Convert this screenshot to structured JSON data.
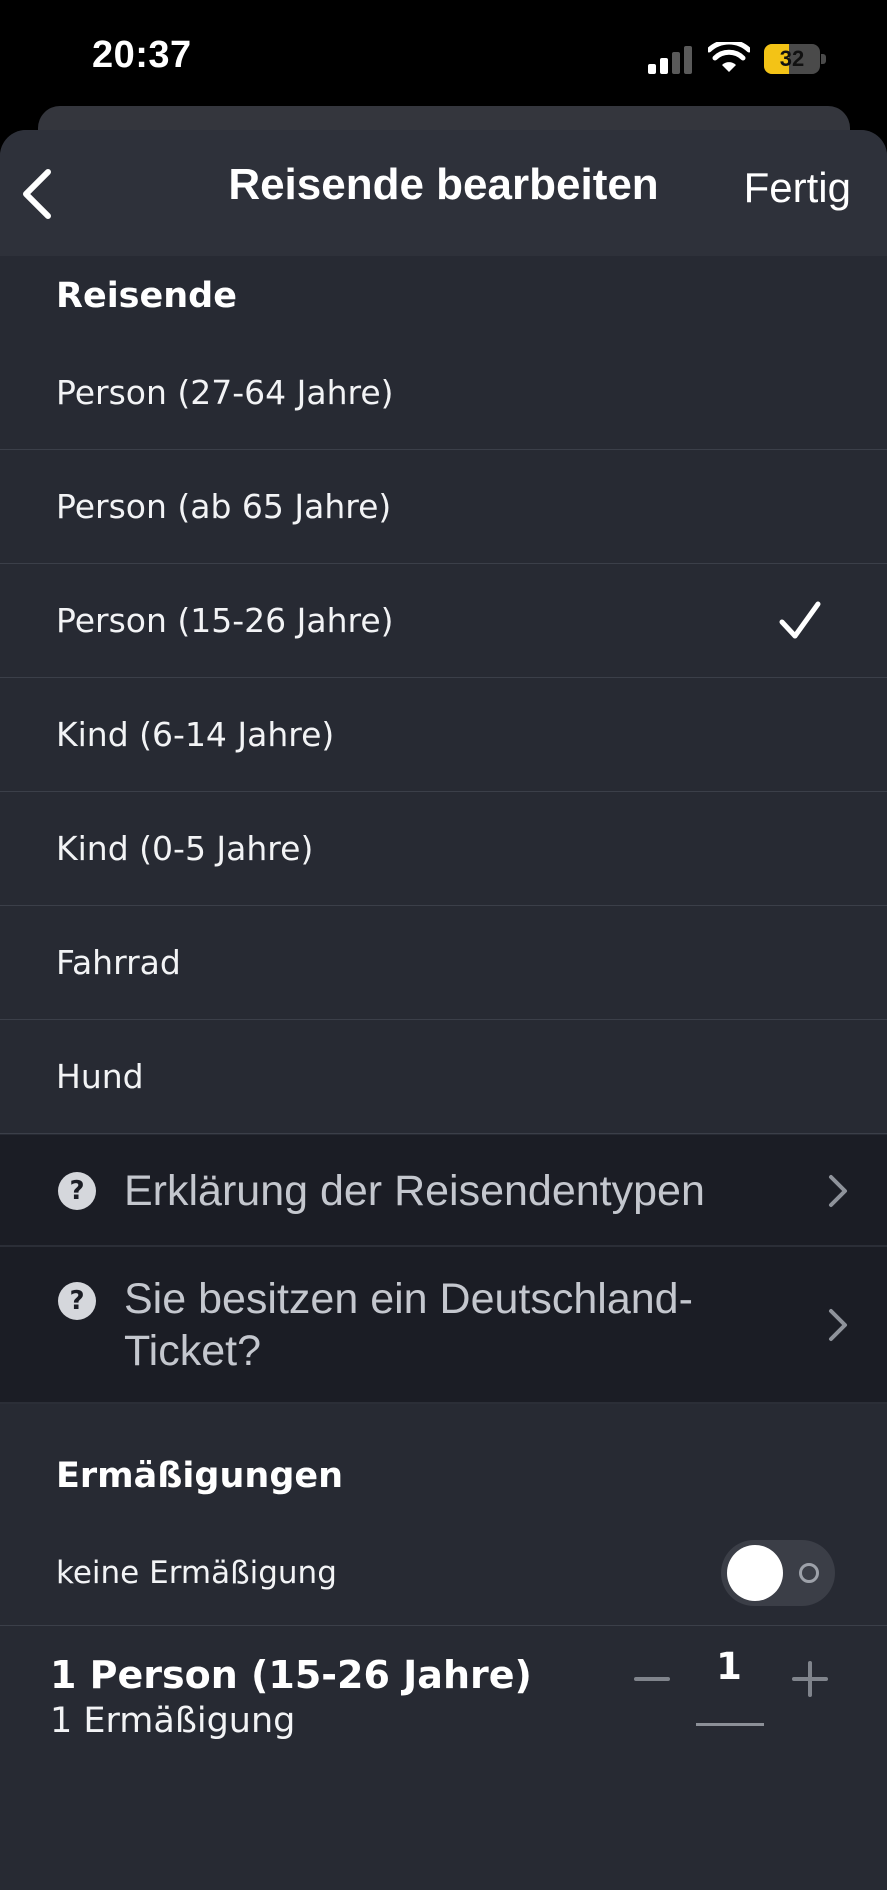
{
  "status_bar": {
    "time": "20:37",
    "battery_level": "32"
  },
  "nav": {
    "title": "Reisende bearbeiten",
    "done_label": "Fertig"
  },
  "travellers": {
    "title": "Reisende",
    "items": [
      {
        "label": "Person (27-64 Jahre)",
        "selected": false
      },
      {
        "label": "Person (ab 65 Jahre)",
        "selected": false
      },
      {
        "label": "Person (15-26 Jahre)",
        "selected": true
      },
      {
        "label": "Kind (6-14 Jahre)",
        "selected": false
      },
      {
        "label": "Kind (0-5 Jahre)",
        "selected": false
      },
      {
        "label": "Fahrrad",
        "selected": false
      },
      {
        "label": "Hund",
        "selected": false
      }
    ]
  },
  "info_links": [
    {
      "text": "Erklärung der Reisendentypen",
      "icon": "question-circle-icon"
    },
    {
      "text": "Sie besitzen ein Deutschland-Ticket?",
      "icon": "question-circle-icon"
    }
  ],
  "discounts": {
    "title": "Ermäßigungen",
    "no_discount_label": "keine Ermäßigung",
    "no_discount_enabled": false
  },
  "summary": {
    "title": "1 Person (15-26 Jahre)",
    "subtitle": "1 Ermäßigung",
    "count": "1"
  },
  "colors": {
    "sheet_background": "#272a33",
    "nav_background": "#2e313a",
    "info_background": "#1b1d25",
    "battery": "#f3c316"
  }
}
